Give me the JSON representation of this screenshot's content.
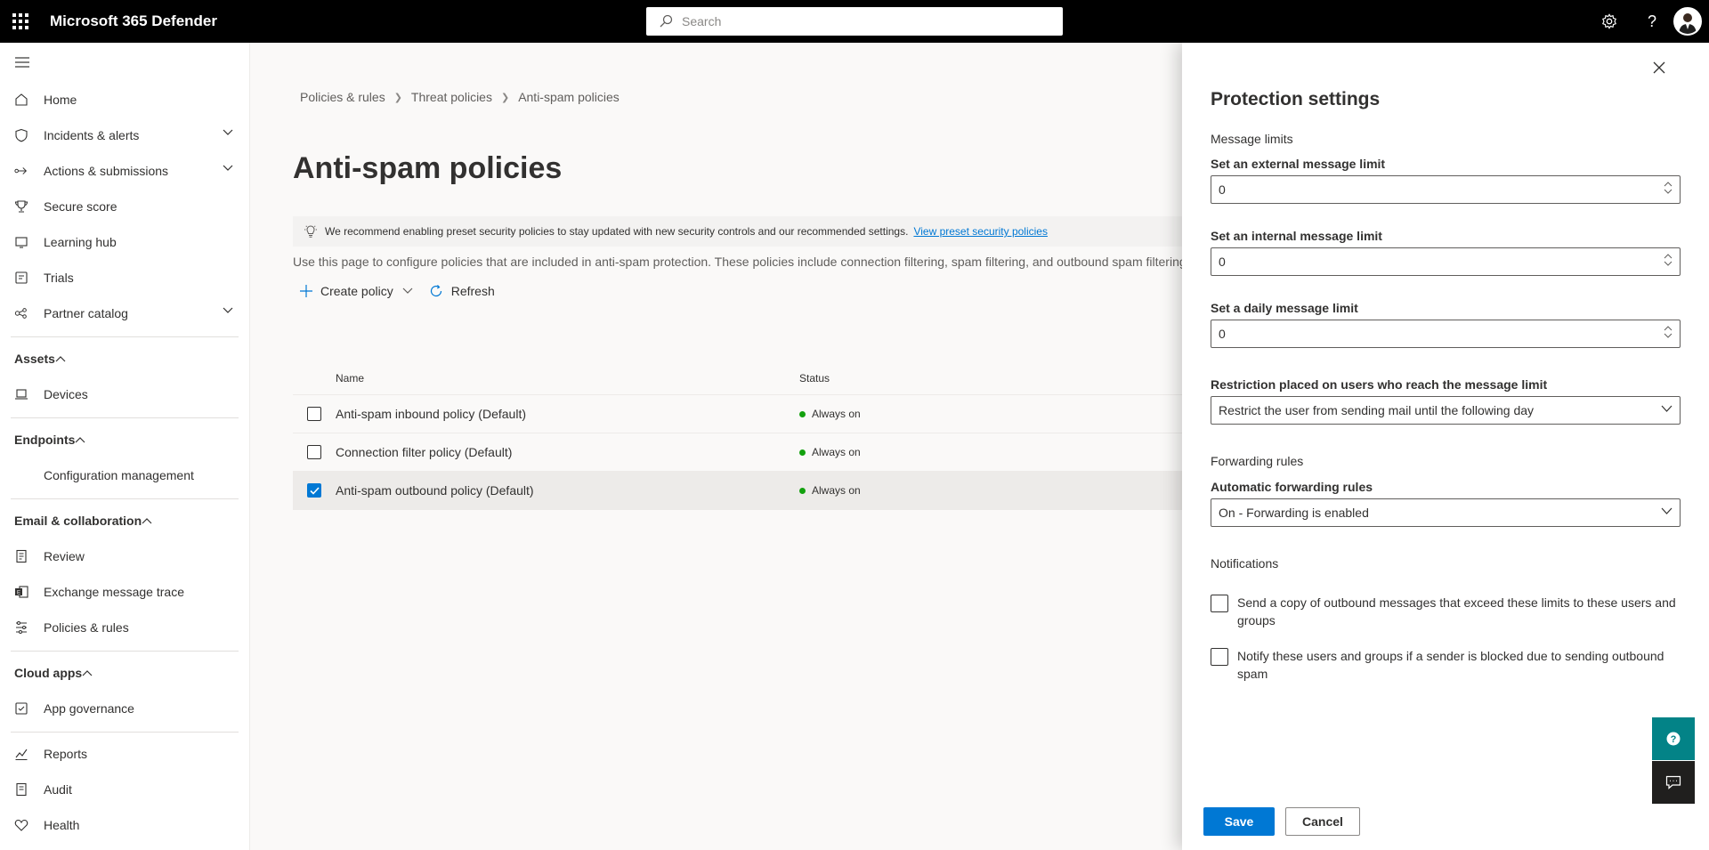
{
  "topbar": {
    "app_title": "Microsoft 365 Defender",
    "search_placeholder": "Search"
  },
  "sidebar": {
    "items": [
      {
        "label": "Home",
        "icon": "home-icon"
      },
      {
        "label": "Incidents & alerts",
        "icon": "shield-icon"
      },
      {
        "label": "Actions & submissions",
        "icon": "actions-icon"
      },
      {
        "label": "Secure score",
        "icon": "trophy-icon"
      },
      {
        "label": "Learning hub",
        "icon": "learning-icon"
      },
      {
        "label": "Trials",
        "icon": "trials-icon"
      },
      {
        "label": "Partner catalog",
        "icon": "partner-icon"
      }
    ],
    "groups": {
      "assets": {
        "label": "Assets",
        "items": [
          {
            "label": "Devices"
          }
        ]
      },
      "endpoints": {
        "label": "Endpoints",
        "items": [
          {
            "label": "Configuration management"
          }
        ]
      },
      "email": {
        "label": "Email & collaboration",
        "items": [
          {
            "label": "Review"
          },
          {
            "label": "Exchange message trace"
          },
          {
            "label": "Policies & rules"
          }
        ]
      },
      "cloud": {
        "label": "Cloud apps",
        "items": [
          {
            "label": "App governance"
          }
        ]
      }
    },
    "bottom": [
      {
        "label": "Reports"
      },
      {
        "label": "Audit"
      },
      {
        "label": "Health"
      }
    ]
  },
  "main": {
    "breadcrumb": [
      "Policies & rules",
      "Threat policies",
      "Anti-spam policies"
    ],
    "title": "Anti-spam policies",
    "banner_text": "We recommend enabling preset security policies to stay updated with new security controls and our recommended settings.",
    "banner_link": "View preset security policies",
    "description": "Use this page to configure policies that are included in anti-spam protection. These policies include connection filtering, spam filtering, and outbound spam filtering.",
    "commands": {
      "create": "Create policy",
      "refresh": "Refresh"
    },
    "table": {
      "columns": [
        "Name",
        "Status"
      ],
      "rows": [
        {
          "name": "Anti-spam inbound policy (Default)",
          "status": "Always on",
          "checked": false
        },
        {
          "name": "Connection filter policy (Default)",
          "status": "Always on",
          "checked": false
        },
        {
          "name": "Anti-spam outbound policy (Default)",
          "status": "Always on",
          "checked": true
        }
      ]
    }
  },
  "panel": {
    "title": "Protection settings",
    "message_limits_heading": "Message limits",
    "external_label": "Set an external message limit",
    "external_value": "0",
    "internal_label": "Set an internal message limit",
    "internal_value": "0",
    "daily_label": "Set a daily message limit",
    "daily_value": "0",
    "restriction_label": "Restriction placed on users who reach the message limit",
    "restriction_value": "Restrict the user from sending mail until the following day",
    "forwarding_heading": "Forwarding rules",
    "auto_forwarding_label": "Automatic forwarding rules",
    "auto_forwarding_value": "On - Forwarding is enabled",
    "notifications_heading": "Notifications",
    "notify_copy_text": "Send a copy of outbound messages that exceed these limits to these users and groups",
    "notify_blocked_text": "Notify these users and groups if a sender is blocked due to sending outbound spam",
    "save_label": "Save",
    "cancel_label": "Cancel"
  },
  "colors": {
    "topbar": "#000000",
    "accent": "#0078d4",
    "status_ok": "#13a10e",
    "help_button": "#038387"
  }
}
